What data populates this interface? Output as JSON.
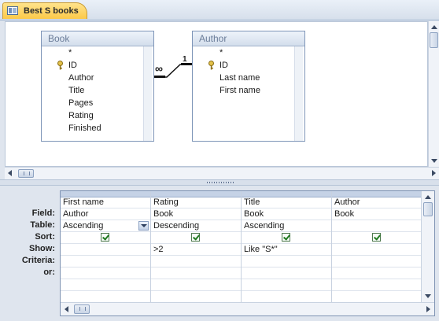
{
  "tab": {
    "title": "Best S books",
    "icon": "query-icon"
  },
  "tables": [
    {
      "name": "Book",
      "fields": [
        "*",
        "ID",
        "Author",
        "Title",
        "Pages",
        "Rating",
        "Finished"
      ],
      "key_field": "ID"
    },
    {
      "name": "Author",
      "fields": [
        "*",
        "ID",
        "Last name",
        "First name"
      ],
      "key_field": "ID"
    }
  ],
  "relationship": {
    "from_label": "∞",
    "to_label": "1"
  },
  "grid": {
    "row_labels": [
      "Field:",
      "Table:",
      "Sort:",
      "Show:",
      "Criteria:",
      "or:"
    ],
    "columns": [
      {
        "field": "First name",
        "table": "Author",
        "sort": "Ascending",
        "show": true,
        "criteria": "",
        "or": ""
      },
      {
        "field": "Rating",
        "table": "Book",
        "sort": "Descending",
        "show": true,
        "criteria": ">2",
        "or": ""
      },
      {
        "field": "Title",
        "table": "Book",
        "sort": "Ascending",
        "show": true,
        "criteria": "Like \"S*\"",
        "or": ""
      },
      {
        "field": "Author",
        "table": "Book",
        "sort": "",
        "show": true,
        "criteria": "",
        "or": ""
      }
    ]
  },
  "colors": {
    "tab_active": "#fcc949",
    "key": "#c9a227",
    "check": "#1f7a1f"
  }
}
